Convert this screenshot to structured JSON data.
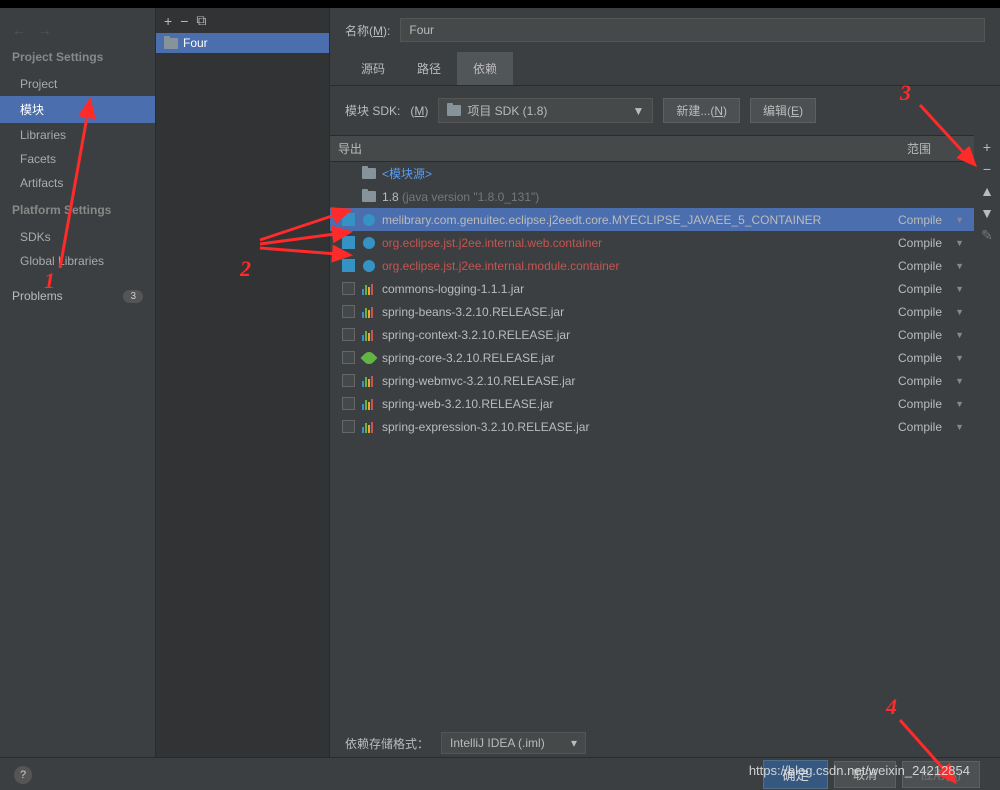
{
  "sidebar": {
    "project_settings_header": "Project Settings",
    "platform_settings_header": "Platform Settings",
    "project_items": [
      {
        "label": "Project"
      },
      {
        "label": "模块"
      },
      {
        "label": "Libraries"
      },
      {
        "label": "Facets"
      },
      {
        "label": "Artifacts"
      }
    ],
    "platform_items": [
      {
        "label": "SDKs"
      },
      {
        "label": "Global Libraries"
      }
    ],
    "problems_label": "Problems",
    "problems_count": "3"
  },
  "module_list": {
    "selected": "Four"
  },
  "right": {
    "name_label": "名称",
    "name_mnemonic": "M",
    "name_value": "Four",
    "tabs": {
      "source": "源码",
      "paths": "路径",
      "deps": "依赖"
    },
    "sdk_label": "模块 SDK:",
    "sdk_mnemonic": "M",
    "sdk_value": "项目 SDK (1.8)",
    "new_btn": "新建...",
    "new_mnemonic": "N",
    "edit_btn": "编辑",
    "edit_mnemonic": "E",
    "th_export": "导出",
    "th_scope": "范围",
    "rows": [
      {
        "type": "folder",
        "name": "<模块源>",
        "class": "blue",
        "scope": ""
      },
      {
        "type": "folder",
        "name": "1.8",
        "dim": " (java version \"1.8.0_131\")",
        "class": "",
        "scope": ""
      },
      {
        "type": "globe",
        "name": "melibrary.com.genuitec.eclipse.j2eedt.core.MYECLIPSE_JAVAEE_5_CONTAINER",
        "class": "",
        "scope": "Compile",
        "selected": true,
        "checked": true
      },
      {
        "type": "globe",
        "name": "org.eclipse.jst.j2ee.internal.web.container",
        "class": "red",
        "scope": "Compile",
        "checked": true
      },
      {
        "type": "globe",
        "name": "org.eclipse.jst.j2ee.internal.module.container",
        "class": "red",
        "scope": "Compile",
        "checked": true
      },
      {
        "type": "lib",
        "name": "commons-logging-1.1.1.jar",
        "scope": "Compile"
      },
      {
        "type": "lib",
        "name": "spring-beans-3.2.10.RELEASE.jar",
        "scope": "Compile"
      },
      {
        "type": "lib",
        "name": "spring-context-3.2.10.RELEASE.jar",
        "scope": "Compile"
      },
      {
        "type": "leaf",
        "name": "spring-core-3.2.10.RELEASE.jar",
        "scope": "Compile"
      },
      {
        "type": "lib",
        "name": "spring-webmvc-3.2.10.RELEASE.jar",
        "scope": "Compile"
      },
      {
        "type": "lib",
        "name": "spring-web-3.2.10.RELEASE.jar",
        "scope": "Compile"
      },
      {
        "type": "lib",
        "name": "spring-expression-3.2.10.RELEASE.jar",
        "scope": "Compile"
      }
    ],
    "storage_label": "依赖存储格式：",
    "storage_value": "IntelliJ IDEA (.iml)"
  },
  "footer": {
    "ok": "确定",
    "cancel": "取消",
    "apply": "应用",
    "apply_mnemonic": "A"
  },
  "annotations": {
    "a1": "1",
    "a2": "2",
    "a3": "3",
    "a4": "4"
  },
  "watermark": "https://blog.csdn.net/weixin_24212854"
}
